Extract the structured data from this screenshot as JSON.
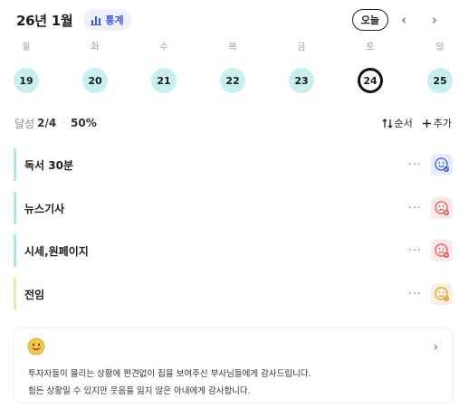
{
  "header": {
    "title": "26년 1월",
    "stats_label": "통계",
    "today_label": "오늘",
    "prev": "‹",
    "next": "›"
  },
  "week": [
    {
      "name": "월",
      "num": "19"
    },
    {
      "name": "화",
      "num": "20"
    },
    {
      "name": "수",
      "num": "21"
    },
    {
      "name": "목",
      "num": "22"
    },
    {
      "name": "금",
      "num": "23"
    },
    {
      "name": "토",
      "num": "24",
      "selected": true
    },
    {
      "name": "일",
      "num": "25"
    }
  ],
  "summary": {
    "label": "달성",
    "count": "2/4",
    "sep": "·",
    "percent": "50%",
    "sort_label": "순서",
    "add_label": "추가"
  },
  "tasks": [
    {
      "name": "독서 30분",
      "more": "···",
      "mood": "smile-check",
      "bar_color": "#a8e6e8"
    },
    {
      "name": "뉴스기사",
      "more": "···",
      "mood": "frown-x",
      "bar_color": "#a8e6e8"
    },
    {
      "name": "시세,원페이지",
      "more": "···",
      "mood": "frown-x",
      "bar_color": "#a8e6e8"
    },
    {
      "name": "전임",
      "more": "···",
      "mood": "frown-warn",
      "bar_color": "#ece9a8"
    }
  ],
  "card": {
    "line1": "투자자들이 몰리는 상황에 편견없이 집을 보여주신 부사님들에게 감사드립니다.",
    "line2": "힘든 상황일 수 있지만 웃음을 잃지 않은 아내에게 감사합니다.",
    "chevron": "›"
  },
  "colors": {
    "accent_blue": "#3d5bd9",
    "day_bg": "#c8eff0",
    "mood_good_bg": "#e6ecff",
    "mood_bad_bg": "#fde8e8",
    "mood_warn_bg": "#fdf0dc"
  }
}
